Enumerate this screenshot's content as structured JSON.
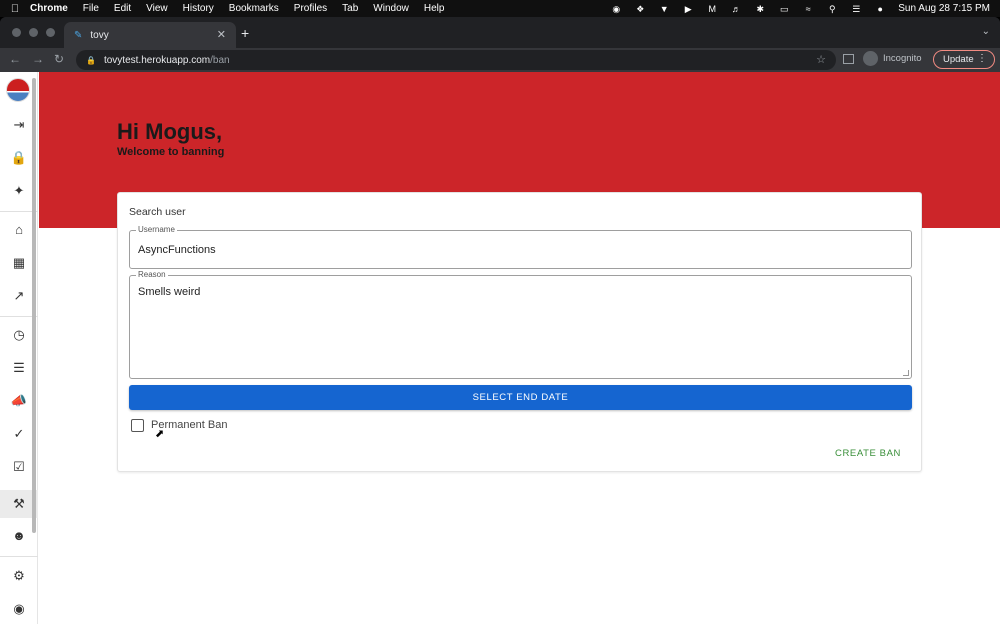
{
  "menubar": {
    "app_name": "Chrome",
    "items": [
      "File",
      "Edit",
      "View",
      "History",
      "Bookmarks",
      "Profiles",
      "Tab",
      "Window",
      "Help"
    ],
    "datetime": "Sun Aug 28  7:15 PM"
  },
  "browser": {
    "tab_title": "tovy",
    "url_host": "tovytest.herokuapp.com",
    "url_path": "/ban",
    "incognito_label": "Incognito",
    "update_label": "Update"
  },
  "sidebar": {
    "icons": [
      "logout-icon",
      "lock-icon",
      "magic-wand-icon",
      "home-icon",
      "grid-icon",
      "external-link-icon",
      "clock-icon",
      "list-icon",
      "megaphone-icon",
      "check-circle-icon",
      "clipboard-check-icon",
      "gavel-icon",
      "people-icon",
      "settings-icon",
      "robot-icon"
    ],
    "active": "gavel-icon"
  },
  "header": {
    "greeting": "Hi Mogus,",
    "subtitle": "Welcome to banning"
  },
  "form": {
    "title": "Search user",
    "username_label": "Username",
    "username_value": "AsyncFunctions",
    "reason_label": "Reason",
    "reason_value": "Smells weird",
    "select_date_label": "SELECT END DATE",
    "permanent_label": "Permanent Ban",
    "permanent_checked": false,
    "create_label": "CREATE BAN"
  },
  "colors": {
    "banner": "#cc2529",
    "primary": "#1565d0",
    "create": "#3a8f3a"
  }
}
